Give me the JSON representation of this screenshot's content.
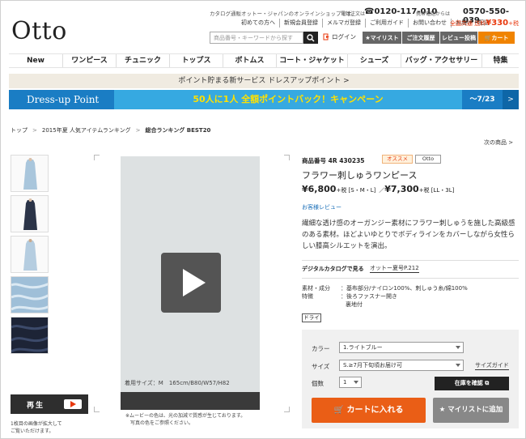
{
  "header": {
    "logo": "Otto",
    "catalog_text": "カタログ通販オットー・ジャパンのオンラインショップです。",
    "phone_label": "電話注文は",
    "phone_number": "0120-117-010",
    "mobile_label": "携帯電話からは",
    "mobile_number": "0570-550-039",
    "links": [
      "初めての方へ",
      "新規会員登録",
      "メルマガ登録",
      "ご利用ガイド",
      "お問い合わせ",
      "お届け・配送"
    ],
    "free_shipping_prefix": "全国共通 送料",
    "free_shipping_price": "¥330",
    "free_shipping_suffix": "+税",
    "search_placeholder": "商品番号・キーワードから探す",
    "login": "ログイン",
    "wishlist": "★マイリスト",
    "history": "ご注文履歴",
    "review": "レビュー投稿",
    "cart": "カート"
  },
  "nav": [
    "New",
    "ワンピース",
    "チュニック",
    "トップス",
    "ボトムス",
    "コート・ジャケット",
    "シューズ",
    "バッグ・アクセサリー",
    "特集"
  ],
  "banner_points": "ポイント貯まる新サービス ドレスアップポイント >",
  "banner_campaign": {
    "left": "Dress-up Point",
    "main": "50人に1人 全額ポイントバック！キャンペーン",
    "date": "～7/23",
    "arrow": ">"
  },
  "breadcrumb": [
    "トップ",
    "2015年夏 人気アイテムランキング",
    "総合ランキング BEST20"
  ],
  "next_product": "次の商品 >",
  "player": {
    "label": "再生",
    "note_line1": "1枚目の画像が拡大して",
    "note_line2": "ご覧いただけます。",
    "size_caption": "着用サイズ：M　165cm/B80/W57/H82",
    "video_note_line1": "※ムービーの色は、光の加減で質感が生じております。",
    "video_note_line2": "写真の色をご参照ください。"
  },
  "product": {
    "id": "商品番号 4R 430235",
    "tag_recommend": "オススメ",
    "tag_brand": "Otto",
    "name": "フラワー刺しゅうワンピース",
    "price1": "¥6,800",
    "price1_note": "+税 [S・M・L]",
    "price_sep": "／",
    "price2": "¥7,300",
    "price2_note": "+税 [LL・3L]",
    "review_link": "お客様レビュー",
    "description": "繊細な透け感のオーガンジー素材にフラワー刺しゅうを施した高級感のある素材。ほどよいゆとりでボディラインをカバーしながら女性らしい膝高シルエットを演出。",
    "digital_label": "デジタルカタログで見る",
    "digital_link": "オットー夏号P.212",
    "material_key": "素材・成分",
    "material_val": "：基布部分/ナイロン100%、刺しゅう糸/綿100%",
    "feature_key": "特徴",
    "feature_val1": "：後ろファスナー開き",
    "feature_val2": "裏地付",
    "care": "ドライ"
  },
  "purchase": {
    "color_label": "カラー",
    "color_value": "1.ライトブルー",
    "size_label": "サイズ",
    "size_value": "S.≥7月下旬頃お届け可",
    "size_guide": "サイズガイド",
    "qty_label": "個数",
    "qty_value": "1",
    "stock_button": "在庫を確認",
    "cart_button": "カートに入れる",
    "wish_button": "★ マイリストに追加"
  },
  "colors": {
    "cart_orange": "#ea5e16",
    "header_cart": "#f08300",
    "banner_blue": "#36a9e1",
    "banner_yellow": "#ffe100",
    "accent_red": "#e8380d"
  }
}
